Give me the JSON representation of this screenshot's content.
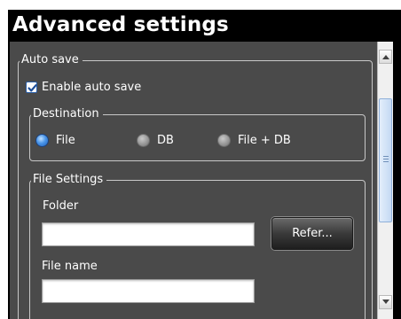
{
  "window": {
    "title": "Advanced settings"
  },
  "auto_save": {
    "legend": "Auto save",
    "enable_label": "Enable auto save",
    "enabled": true
  },
  "destination": {
    "legend": "Destination",
    "options": [
      {
        "label": "File",
        "selected": true
      },
      {
        "label": "DB",
        "selected": false
      },
      {
        "label": "File + DB",
        "selected": false
      }
    ]
  },
  "file_settings": {
    "legend": "File Settings",
    "folder_label": "Folder",
    "folder_value": "",
    "refer_label": "Refer...",
    "file_name_label": "File name",
    "file_name_value": ""
  },
  "colors": {
    "titlebar": "#000000",
    "panel": "#4a4a4a",
    "radio_selected": "#3a86e0",
    "checkbox_check": "#1e4f9a"
  }
}
